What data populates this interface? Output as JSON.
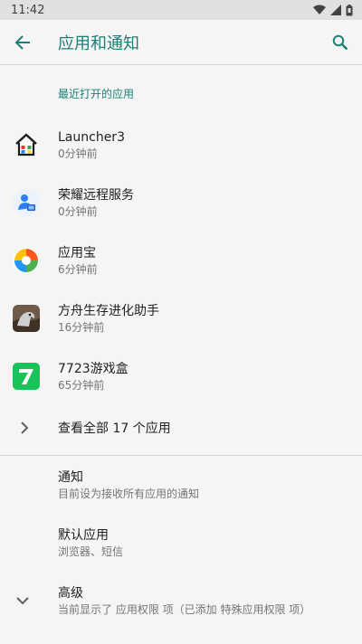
{
  "status_bar": {
    "time": "11:42"
  },
  "app_bar": {
    "title": "应用和通知"
  },
  "recent": {
    "header": "最近打开的应用",
    "apps": [
      {
        "name": "Launcher3",
        "time": "0分钟前"
      },
      {
        "name": "荣耀远程服务",
        "time": "0分钟前"
      },
      {
        "name": "应用宝",
        "time": "6分钟前"
      },
      {
        "name": "方舟生存进化助手",
        "time": "16分钟前"
      },
      {
        "name": "7723游戏盒",
        "time": "65分钟前"
      }
    ],
    "see_all": "查看全部 17 个应用"
  },
  "settings": [
    {
      "title": "通知",
      "subtitle": "目前设为接收所有应用的通知"
    },
    {
      "title": "默认应用",
      "subtitle": "浏览器、短信"
    },
    {
      "title": "高级",
      "subtitle": "当前显示了 应用权限 项（已添加 特殊应用权限 项）"
    }
  ],
  "colors": {
    "accent": "#1a7f75"
  }
}
